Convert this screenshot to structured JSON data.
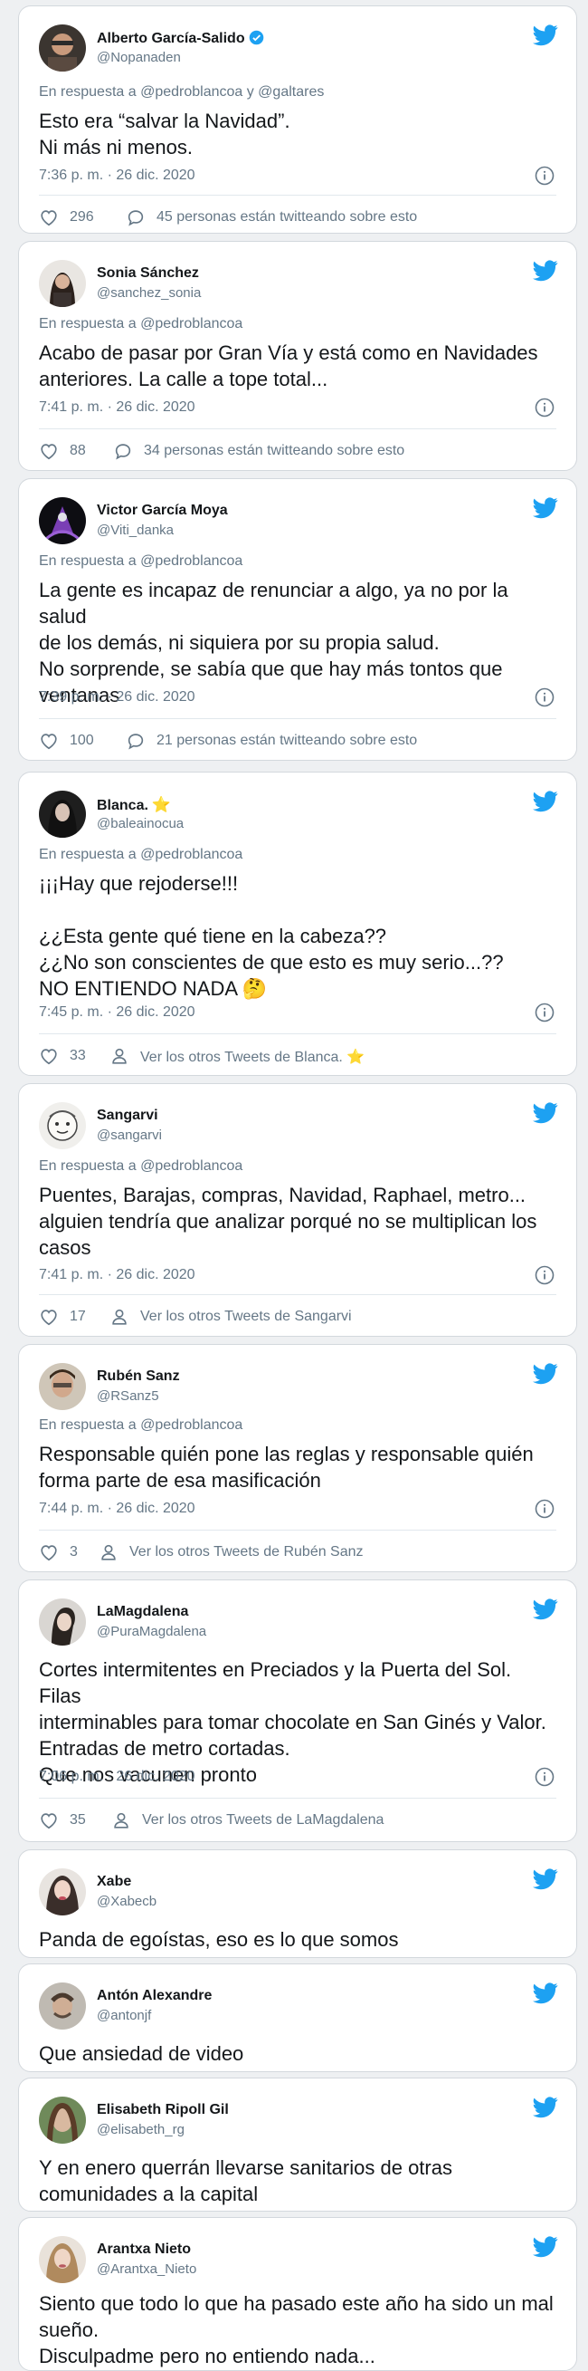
{
  "accent": "#1da1f2",
  "tweets": [
    {
      "name": "Alberto García-Salido",
      "handle": "@Nopanaden",
      "verified": true,
      "reply_prefix": "En respuesta a ",
      "reply_mentions": "@pedroblancoa y @galtares",
      "text": "Esto era “salvar la Navidad”.\nNi más ni menos.",
      "time": "7:36 p. m. · 26 dic. 2020",
      "likes": "296",
      "secondary": "45 personas están twitteando sobre esto",
      "secondary_icon": "comment-icon"
    },
    {
      "name": "Sonia Sánchez",
      "handle": "@sanchez_sonia",
      "reply_prefix": "En respuesta a ",
      "reply_mentions": "@pedroblancoa",
      "text": "Acabo de pasar por Gran Vía y está como en Navidades\nanteriores. La calle a tope total...",
      "time": "7:41 p. m. · 26 dic. 2020",
      "likes": "88",
      "secondary": "34 personas están twitteando sobre esto",
      "secondary_icon": "comment-icon"
    },
    {
      "name": "Victor García Moya",
      "handle": "@Viti_danka",
      "reply_prefix": "En respuesta a ",
      "reply_mentions": "@pedroblancoa",
      "text": "La gente es incapaz de renunciar a algo, ya no por la salud\nde los demás, ni siquiera por su propia salud.\nNo sorprende, se sabía que que hay más tontos que\nventanas",
      "time": "7:39 p. m. · 26 dic. 2020",
      "likes": "100",
      "secondary": "21 personas están twitteando sobre esto",
      "secondary_icon": "comment-icon"
    },
    {
      "name": "Blanca.",
      "name_emoji": "⭐",
      "handle": "@baleainocua",
      "reply_prefix": "En respuesta a ",
      "reply_mentions": "@pedroblancoa",
      "text": "¡¡¡Hay que rejoderse!!!\n\n¿¿Esta gente qué tiene en la cabeza??\n¿¿No son conscientes de que esto es muy serio...??\nNO ENTIENDO NADA 🤔",
      "time": "7:45 p. m. · 26 dic. 2020",
      "likes": "33",
      "secondary": "Ver los otros Tweets de Blanca. ⭐",
      "secondary_icon": "person-icon"
    },
    {
      "name": "Sangarvi",
      "handle": "@sangarvi",
      "reply_prefix": "En respuesta a ",
      "reply_mentions": "@pedroblancoa",
      "text": "Puentes, Barajas, compras, Navidad, Raphael, metro...\nalguien tendría que analizar porqué no se multiplican los\ncasos",
      "time": "7:41 p. m. · 26 dic. 2020",
      "likes": "17",
      "secondary": "Ver los otros Tweets de Sangarvi",
      "secondary_icon": "person-icon"
    },
    {
      "name": "Rubén Sanz",
      "handle": "@RSanz5",
      "reply_prefix": "En respuesta a ",
      "reply_mentions": "@pedroblancoa",
      "text": "Responsable quién pone las reglas y responsable quién\nforma parte de esa masificación",
      "time": "7:44 p. m. · 26 dic. 2020",
      "likes": "3",
      "secondary": "Ver los otros Tweets de Rubén Sanz",
      "secondary_icon": "person-icon"
    },
    {
      "name": "LaMagdalena",
      "handle": "@PuraMagdalena",
      "reply_prefix": "",
      "reply_mentions": "",
      "text": "Cortes intermitentes en Preciados y la Puerta del Sol. Filas\ninterminables para tomar chocolate en San Ginés y Valor.\nEntradas de metro cortadas.\nQue nos vacunen pronto",
      "time": "7:06 p. m. · 26 dic. 2020",
      "likes": "35",
      "secondary": "Ver los otros Tweets de LaMagdalena",
      "secondary_icon": "person-icon"
    },
    {
      "name": "Xabe",
      "handle": "@Xabecb",
      "text": "Panda de egoístas, eso es lo que somos"
    },
    {
      "name": "Antón Alexandre",
      "handle": "@antonjf",
      "text": "Que ansiedad de video"
    },
    {
      "name": "Elisabeth Ripoll Gil",
      "handle": "@elisabeth_rg",
      "text": "Y en enero querrán llevarse sanitarios de otras\ncomunidades a la capital"
    },
    {
      "name": "Arantxa Nieto",
      "handle": "@Arantxa_Nieto",
      "text": "Siento que todo lo que ha pasado este año ha sido un mal\nsueño.\nDisculpadme pero no entiendo nada..."
    }
  ]
}
